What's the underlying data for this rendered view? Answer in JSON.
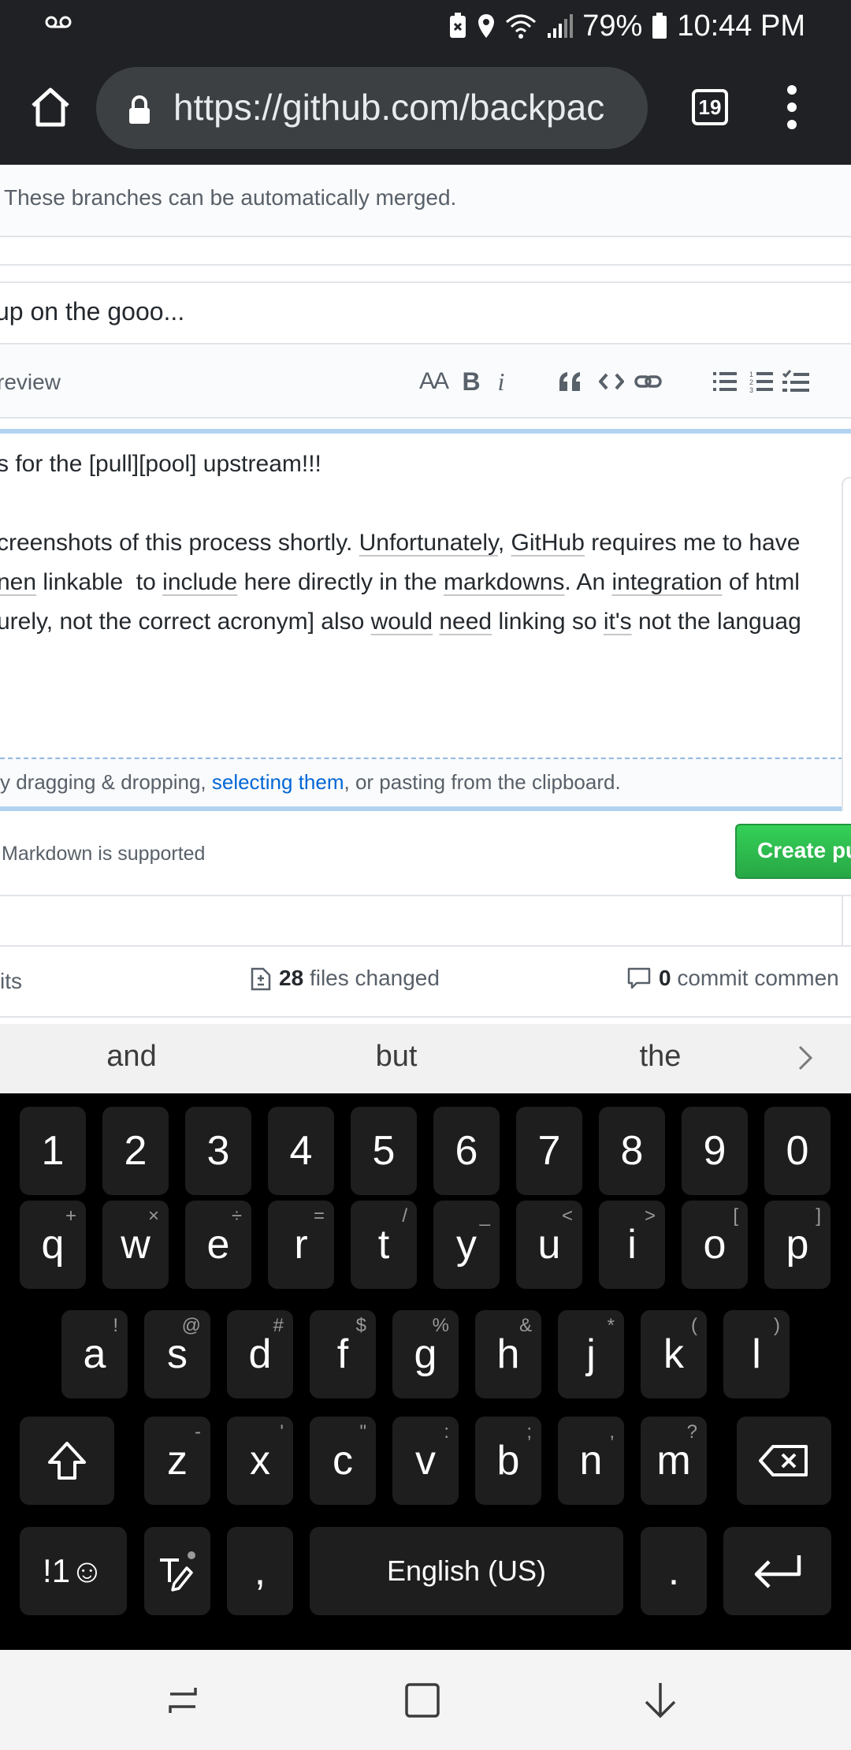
{
  "status_bar": {
    "battery": "79%",
    "time": "10:44 PM"
  },
  "browser": {
    "url": "https://github.com/backpac",
    "tab_count": "19"
  },
  "page": {
    "merge_status": "These branches can be automatically merged.",
    "title_value": "up on the gooo...",
    "preview_tab": "review",
    "toolbar": {
      "heading": "AA",
      "bold": "B",
      "italic": "i"
    },
    "editor_lines": {
      "line1": "s for the [pull][pool] upstream!!!",
      "line2_a": "creenshots of this process shortly. ",
      "line2_b": "Unfortunately",
      "line2_c": ", ",
      "line2_d": "GitHub",
      "line2_e": " requires me to have",
      "line3_a": "nen",
      "line3_b": " linkable  to ",
      "line3_c": "include",
      "line3_d": " here directly in the ",
      "line3_e": "markdowns",
      "line3_f": ". An ",
      "line3_g": "integration",
      "line3_h": " of html",
      "line4_a": "urely, not the correct acronym] also ",
      "line4_b": "would",
      "line4_c": " ",
      "line4_d": "need",
      "line4_e": " linking so ",
      "line4_f": "it's",
      "line4_g": " not the languag"
    },
    "attach": {
      "prefix": "y dragging & dropping, ",
      "link": "selecting them",
      "suffix": ", or pasting from the clipboard."
    },
    "markdown_note": "Markdown is supported",
    "create_button": "Create pu",
    "stats": {
      "commits_label": "its",
      "files_count": "28",
      "files_label": "files changed",
      "comments_count": "0",
      "comments_label": "commit commen"
    }
  },
  "keyboard": {
    "suggestions": [
      "and",
      "but",
      "the"
    ],
    "number_row": [
      "1",
      "2",
      "3",
      "4",
      "5",
      "6",
      "7",
      "8",
      "9",
      "0"
    ],
    "row1": [
      "q",
      "w",
      "e",
      "r",
      "t",
      "y",
      "u",
      "i",
      "o",
      "p"
    ],
    "row1_hints": [
      "+",
      "×",
      "÷",
      "=",
      "/",
      "_",
      "<",
      ">",
      "[",
      "]"
    ],
    "row2": [
      "a",
      "s",
      "d",
      "f",
      "g",
      "h",
      "j",
      "k",
      "l"
    ],
    "row2_hints": [
      "!",
      "@",
      "#",
      "$",
      "%",
      "&",
      "*",
      "(",
      ")"
    ],
    "row3": [
      "z",
      "x",
      "c",
      "v",
      "b",
      "n",
      "m"
    ],
    "row3_hints": [
      "-",
      "'",
      "\"",
      ":",
      ";",
      ",",
      "?"
    ],
    "symbols_key": "!1☺",
    "comma": ",",
    "space": "English (US)",
    "period": "."
  }
}
